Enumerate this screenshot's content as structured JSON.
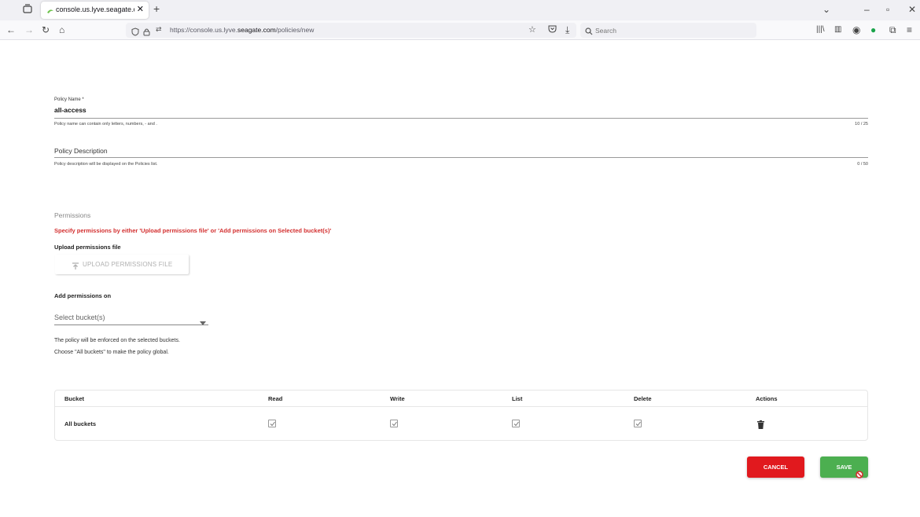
{
  "browser": {
    "tab_title": "console.us.lyve.seagate.com/po",
    "url_prefix": "https://console.us.lyve.",
    "url_domain": "seagate.com",
    "url_path": "/policies/new",
    "search_placeholder": "Search"
  },
  "form": {
    "policy_name_label": "Policy Name *",
    "policy_name_value": "all-access",
    "policy_name_helper": "Policy name can contain only letters, numbers, - and .",
    "policy_name_counter": "10 / 25",
    "policy_description_placeholder": "Policy Description",
    "policy_description_helper": "Policy description will be displayed on the Policies list.",
    "policy_description_counter": "0 / 50"
  },
  "permissions": {
    "section_title": "Permissions",
    "warning": "Specify permissions by either 'Upload permissions file' or 'Add permissions on Selected bucket(s)'",
    "upload_title": "Upload permissions file",
    "upload_button": "UPLOAD PERMISSIONS FILE",
    "add_on_title": "Add permissions on",
    "select_placeholder": "Select bucket(s)",
    "note_line1": "The policy will be enforced on the selected buckets.",
    "note_line2": "Choose \"All buckets\" to make the policy global."
  },
  "table": {
    "headers": [
      "Bucket",
      "Read",
      "Write",
      "List",
      "Delete",
      "Actions"
    ],
    "rows": [
      {
        "bucket": "All buckets",
        "read": true,
        "write": true,
        "list": true,
        "delete": true
      }
    ]
  },
  "buttons": {
    "cancel": "CANCEL",
    "save": "SAVE"
  },
  "colors": {
    "cancel": "#e1191e",
    "save": "#4caf50",
    "warning": "#d32f2f"
  }
}
